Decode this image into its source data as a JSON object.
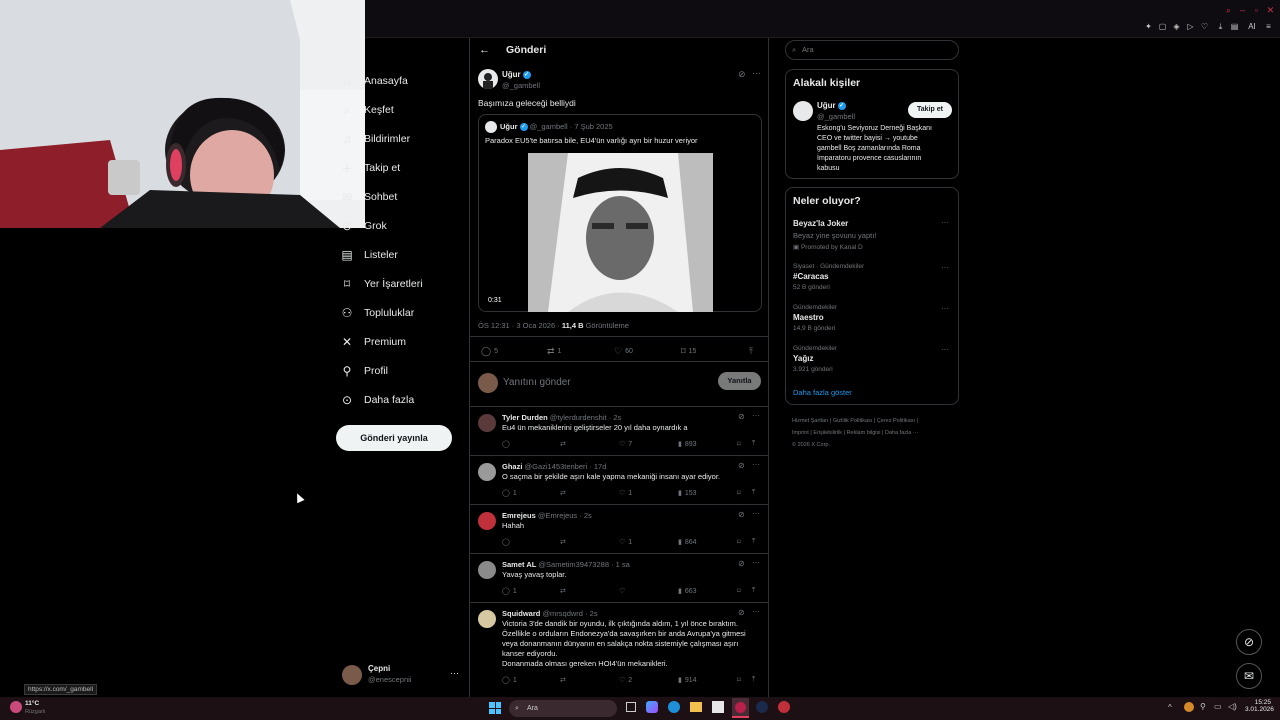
{
  "nav": {
    "items": [
      {
        "label": "Anasayfa",
        "icon": "home-icon"
      },
      {
        "label": "Keşfet",
        "icon": "explore-icon"
      },
      {
        "label": "Bildirimler",
        "icon": "bell-icon"
      },
      {
        "label": "Takip et",
        "icon": "follow-icon"
      },
      {
        "label": "Sohbet",
        "icon": "chat-icon"
      },
      {
        "label": "Grok",
        "icon": "grok-icon"
      },
      {
        "label": "Listeler",
        "icon": "list-icon"
      },
      {
        "label": "Yer İşaretleri",
        "icon": "bookmark-icon"
      },
      {
        "label": "Topluluklar",
        "icon": "communities-icon"
      },
      {
        "label": "Premium",
        "icon": "x-logo-icon"
      },
      {
        "label": "Profil",
        "icon": "person-icon"
      },
      {
        "label": "Daha fazla",
        "icon": "more-circle-icon"
      }
    ],
    "post_button": "Gönderi yayınla",
    "account": {
      "name": "Çepni",
      "handle": "@enescepnii"
    }
  },
  "header": {
    "title": "Gönderi"
  },
  "post": {
    "name": "Uğur",
    "handle": "@_gambell",
    "text": "Başımıza geleceği belliydi",
    "quote": {
      "name": "Uğur",
      "handle": "@_gambell",
      "date": "· 7 Şub 2025",
      "text": "Paradox EU5'te batırsa bile, EU4'ün varlığı ayrı bir huzur veriyor",
      "video_duration": "0:31"
    },
    "meta_time": "ÖS 12:31 · 3 Oca 2026 ·",
    "views": "11,4 B",
    "views_label": "Görüntüleme",
    "stats": {
      "replies": "5",
      "reposts": "1",
      "likes": "60",
      "bookmarks": "15"
    }
  },
  "composer": {
    "placeholder": "Yanıtını gönder",
    "button": "Yanıtla"
  },
  "replies": [
    {
      "name": "Tyler Durden",
      "handle": "@tylerdurdenshit",
      "time": "· 2s",
      "lines": [
        "Eu4 ün mekaniklerini geliştirseler 20 yıl daha oynardık a"
      ],
      "r": "",
      "rt": "",
      "l": "7",
      "v": "893"
    },
    {
      "name": "Ghazi",
      "handle": "@Gazi1453tenberi",
      "time": "· 17d",
      "lines": [
        "O saçma bir şekilde aşırı kale yapma mekaniği insanı ayar ediyor."
      ],
      "r": "1",
      "rt": "",
      "l": "1",
      "v": "153"
    },
    {
      "name": "Emrejeus",
      "handle": "@Emrejeus",
      "time": "· 2s",
      "lines": [
        "Hahah"
      ],
      "r": "",
      "rt": "",
      "l": "1",
      "v": "864"
    },
    {
      "name": "Samet AL",
      "handle": "@Sametim39473288",
      "time": "· 1 sa",
      "lines": [
        "Yavaş yavaş toplar."
      ],
      "r": "1",
      "rt": "",
      "l": "",
      "v": "663"
    },
    {
      "name": "Squidward",
      "handle": "@mrsqdwrd",
      "time": "· 2s",
      "lines": [
        "Victoria 3'de dandik bir oyundu, ilk çıktığında aldım, 1 yıl önce bıraktım.",
        "Özellikle o orduların Endonezya'da savaşırken bir anda Avrupa'ya gitmesi",
        "veya donanmanın dünyanın en salakça nokta sistemiyle çalışması aşırı",
        "kanser ediyordu.",
        "Donanmada olması gereken HOI4'ün mekanikleri."
      ],
      "r": "1",
      "rt": "",
      "l": "2",
      "v": "914"
    }
  ],
  "right": {
    "search_placeholder": "Ara",
    "people_title": "Alakalı kişiler",
    "person": {
      "name": "Uğur",
      "handle": "@_gambell",
      "follow": "Takip et",
      "bio": [
        "Eskong'u Seviyoruz Derneği Başkanı",
        "CEO ve twitter bayisi → youtube",
        "gambell Boş zamanlarında Roma",
        "İmparatoru provence casuslarının",
        "kabusu"
      ]
    },
    "trends_title": "Neler oluyor?",
    "trends": [
      {
        "name": "Beyaz'la Joker",
        "sub": "Beyaz yine şovunu yaptı!",
        "meta": "Promoted by Kanal D"
      },
      {
        "cat": "Siyaset · Gündemdekiler",
        "name": "#Caracas",
        "meta": "52 B gönderi"
      },
      {
        "cat": "Gündemdekiler",
        "name": "Maestro",
        "meta": "14,9 B gönderi"
      },
      {
        "cat": "Gündemdekiler",
        "name": "Yağız",
        "meta": "3.921 gönderi"
      }
    ],
    "show_more": "Daha fazla göster",
    "footer": [
      "Hizmet Şartları",
      "Gizlilik Politikası",
      "Çerez Politikası",
      "Imprint",
      "Erişilebilirlik",
      "Reklam bilgisi",
      "Daha fazla ···",
      "© 2026 X Corp."
    ]
  },
  "status": {
    "url": "https://x.com/_gambell"
  },
  "taskbar": {
    "weather": "11°C",
    "weather_sub": "Rüzgarlı",
    "search": "Ara",
    "time": "15:25",
    "date": "3.01.2026"
  }
}
